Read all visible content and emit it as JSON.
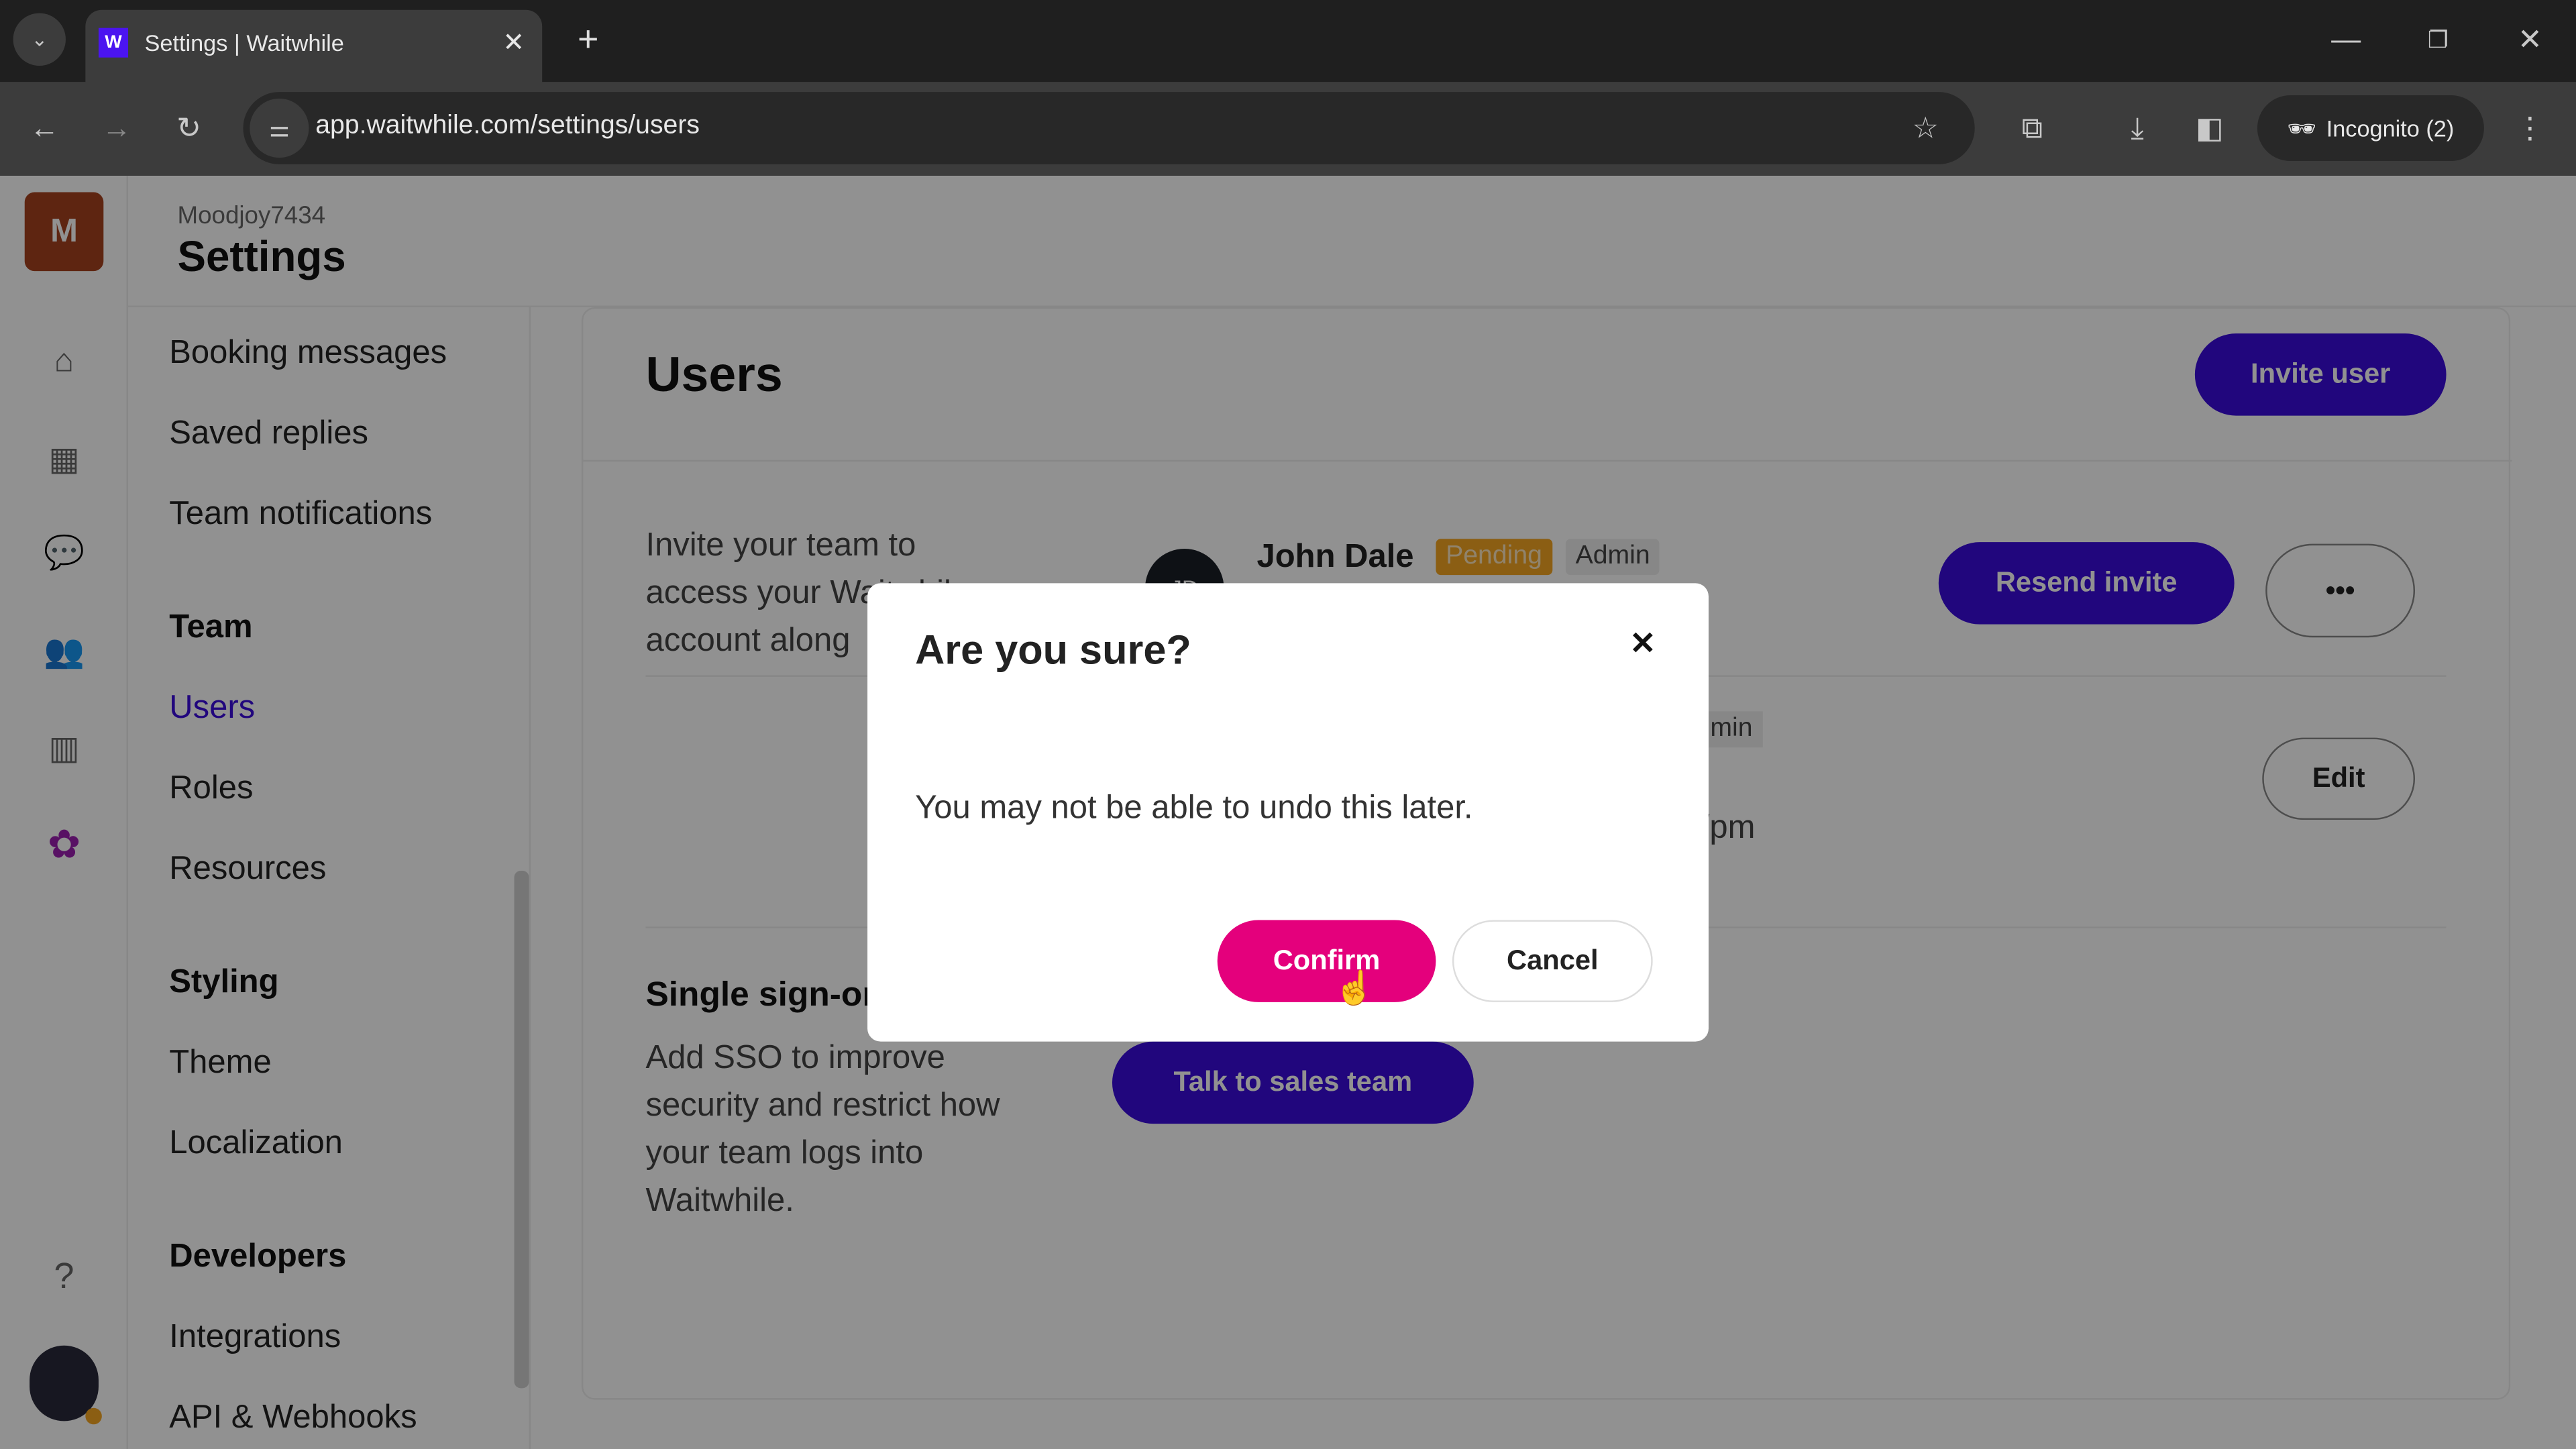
{
  "browser": {
    "tab_title": "Settings | Waitwhile",
    "url": "app.waitwhile.com/settings/users",
    "profile": "Incognito (2)"
  },
  "header": {
    "account": "Moodjoy7434",
    "title": "Settings",
    "avatar_letter": "M"
  },
  "settings_nav": {
    "items_top": [
      "Booking messages",
      "Saved replies",
      "Team notifications"
    ],
    "team": {
      "heading": "Team",
      "items": [
        "Users",
        "Roles",
        "Resources"
      ]
    },
    "styling": {
      "heading": "Styling",
      "items": [
        "Theme",
        "Localization"
      ]
    },
    "developers": {
      "heading": "Developers",
      "items": [
        "Integrations",
        "API & Webhooks"
      ]
    },
    "active": "Users"
  },
  "main": {
    "title": "Users",
    "invite_button": "Invite user",
    "intro": "Invite your team to access your Waitwhile account along",
    "users": [
      {
        "name": "John Dale",
        "initials": "JD",
        "status": "Pending",
        "role": "Admin",
        "action": "Resend invite",
        "more": "•••"
      },
      {
        "role_partial": "min",
        "time_partial": "/pm",
        "action": "Edit"
      }
    ],
    "sso": {
      "title": "Single sign-on",
      "text": "Add SSO to improve security and restrict how your team logs into Waitwhile.",
      "button": "Talk to sales team"
    }
  },
  "modal": {
    "title": "Are you sure?",
    "message": "You may not be able to undo this later.",
    "confirm": "Confirm",
    "cancel": "Cancel",
    "close": "✕"
  },
  "colors": {
    "accent": "#3b0bdc",
    "confirm": "#e4007c",
    "pending": "#f5a623",
    "avatar": "#a5421f"
  }
}
